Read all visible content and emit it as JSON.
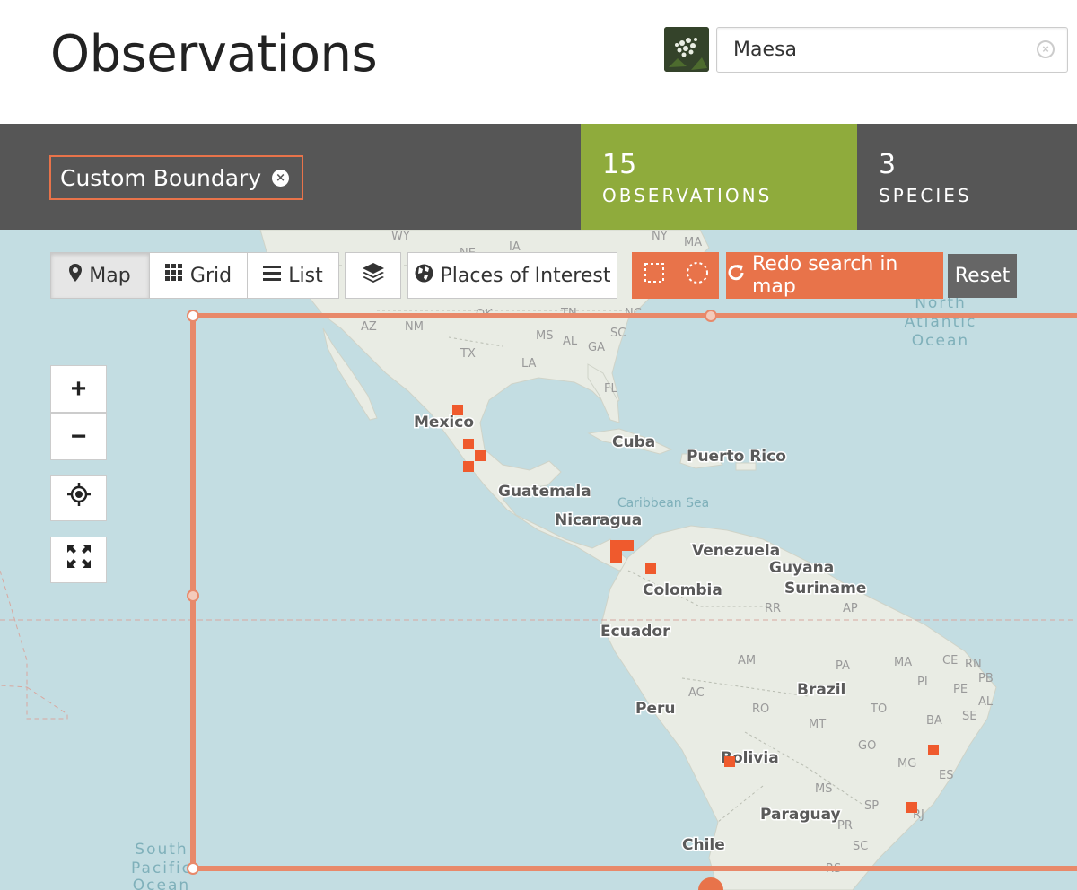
{
  "header": {
    "title": "Observations"
  },
  "taxon_search": {
    "value": "Maesa",
    "thumb_icon": "flower-thumbnail"
  },
  "boundary_chip": {
    "label": "Custom Boundary"
  },
  "stats": {
    "observations": {
      "count": "15",
      "label": "OBSERVATIONS"
    },
    "species": {
      "count": "3",
      "label": "SPECIES"
    }
  },
  "toolbar": {
    "map": "Map",
    "grid": "Grid",
    "list": "List",
    "places": "Places of Interest",
    "redo": "Redo search in map",
    "reset": "Reset"
  },
  "map_controls": {
    "zoom_in": "+",
    "zoom_out": "−"
  },
  "map_labels": {
    "north_atlantic": [
      "North",
      "Atlantic",
      "Ocean"
    ],
    "south_pacific": [
      "South",
      "Pacific",
      "Ocean"
    ],
    "caribbean": "Caribbean Sea",
    "countries": {
      "mexico": "Mexico",
      "cuba": "Cuba",
      "puerto_rico": "Puerto Rico",
      "guatemala": "Guatemala",
      "nicaragua": "Nicaragua",
      "venezuela": "Venezuela",
      "guyana": "Guyana",
      "suriname": "Suriname",
      "colombia": "Colombia",
      "ecuador": "Ecuador",
      "peru": "Peru",
      "brazil": "Brazil",
      "bolivia": "Bolivia",
      "paraguay": "Paraguay",
      "chile": "Chile"
    },
    "states": {
      "wy": "WY",
      "ne": "NE",
      "ia": "IA",
      "ny": "NY",
      "ma": "MA",
      "ok": "OK",
      "tn": "TN",
      "nc": "NC",
      "az": "AZ",
      "nm": "NM",
      "ms": "MS",
      "al": "AL",
      "ga": "GA",
      "sc": "SC",
      "tx": "TX",
      "la": "LA",
      "fl": "FL",
      "rr": "RR",
      "ap": "AP",
      "am": "AM",
      "pa": "PA",
      "ma_br": "MA",
      "ce": "CE",
      "rn": "RN",
      "pb": "PB",
      "pi": "PI",
      "pe": "PE",
      "al_br": "AL",
      "se": "SE",
      "ac": "AC",
      "ro": "RO",
      "to": "TO",
      "ba": "BA",
      "mt": "MT",
      "go": "GO",
      "mg": "MG",
      "es": "ES",
      "ms_br": "MS",
      "sp": "SP",
      "rj": "RJ",
      "pr": "PR",
      "sc_br": "SC",
      "rs": "RS"
    }
  },
  "colors": {
    "accent": "#e8734a",
    "stat_green": "#8fab3c",
    "bar": "#565656",
    "water": "#c3dde2",
    "land": "#e9ece4"
  },
  "icons": [
    "map-marker-icon",
    "grid-icon",
    "list-icon",
    "layers-icon",
    "globe-icon",
    "rectangle-select-icon",
    "circle-select-icon",
    "refresh-icon",
    "locate-icon",
    "fullscreen-icon",
    "clear-icon"
  ]
}
